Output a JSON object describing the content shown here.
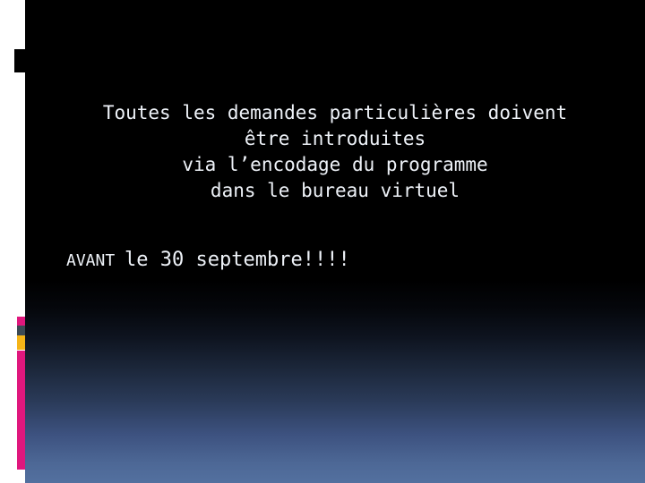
{
  "slide": {
    "background": {
      "top_color": "#000000",
      "bottom_color": "#53709f",
      "gutter_color": "#ffffff"
    },
    "accents": {
      "pink": "#e0177d",
      "slate": "#3c4a54",
      "gold": "#f5b417",
      "block": "#000000"
    },
    "body": {
      "text": "Toutes les demandes particulières doivent\nêtre introduites\nvia l’encodage du programme\ndans le bureau virtuel",
      "color": "#eef2f8"
    },
    "deadline": {
      "prefix": "AVANT ",
      "emphasis": "le 30 septembre!!!!",
      "color": "#eef2f8"
    }
  }
}
